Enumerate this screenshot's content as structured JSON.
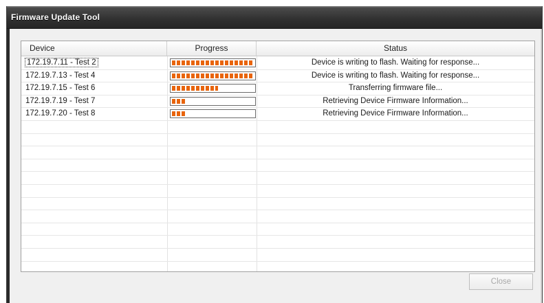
{
  "window": {
    "title": "Firmware Update Tool"
  },
  "grid": {
    "columns": [
      "Device",
      "Progress",
      "Status"
    ],
    "rows": [
      {
        "device": "172.19.7.11 - Test 2",
        "progress": 1.0,
        "status": "Device is writing to flash. Waiting for response...",
        "focused": true
      },
      {
        "device": "172.19.7.13 - Test 4",
        "progress": 1.0,
        "status": "Device is writing to flash. Waiting for response...",
        "focused": false
      },
      {
        "device": "172.19.7.15 - Test 6",
        "progress": 0.56,
        "status": "Transferring firmware file...",
        "focused": false
      },
      {
        "device": "172.19.7.19 - Test 7",
        "progress": 0.16,
        "status": "Retrieving Device Firmware Information...",
        "focused": false
      },
      {
        "device": "172.19.7.20 - Test 8",
        "progress": 0.16,
        "status": "Retrieving Device Firmware Information...",
        "focused": false
      }
    ]
  },
  "footer": {
    "close_label": "Close"
  },
  "colors": {
    "progress_fill": "#e8640c",
    "title_bar": "#303030"
  }
}
